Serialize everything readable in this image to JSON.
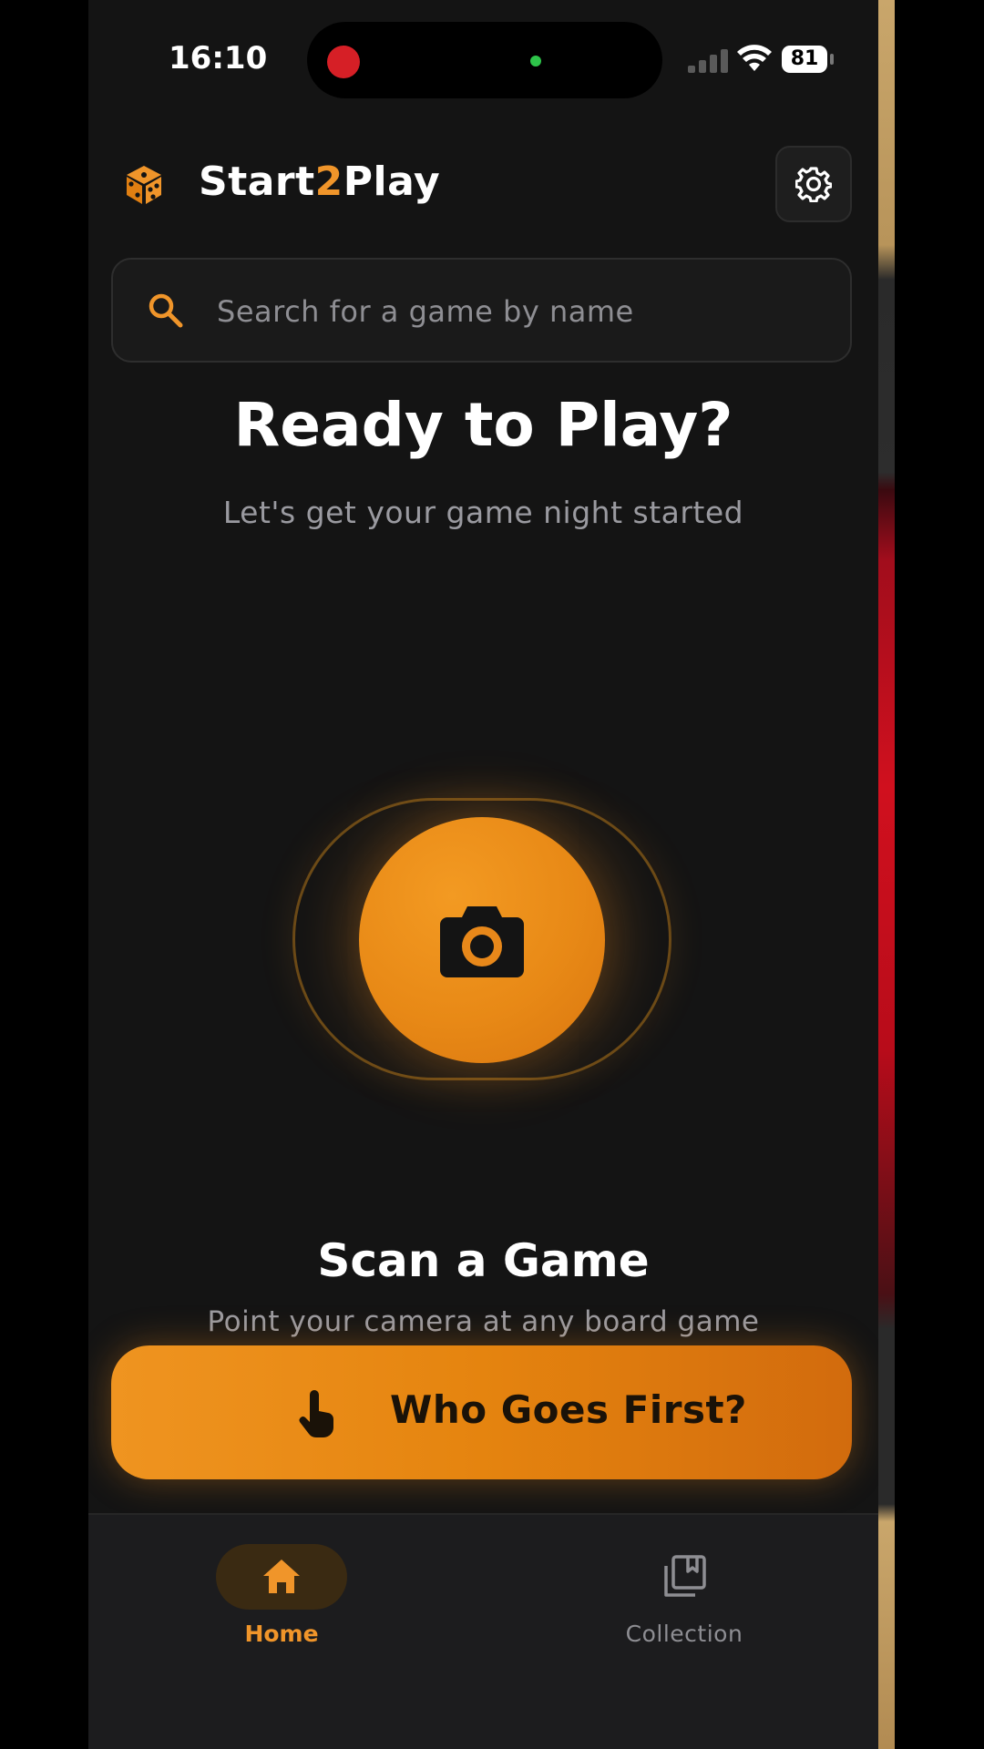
{
  "status_bar": {
    "time": "16:10",
    "battery": "81"
  },
  "header": {
    "title_part1": "Start",
    "title_accent": "2",
    "title_part2": "Play",
    "logo_icon": "dice-icon",
    "settings_icon": "gear-icon"
  },
  "search": {
    "placeholder": "Search for a game by name",
    "value": "",
    "icon": "search-icon"
  },
  "hero": {
    "title": "Ready to Play?",
    "subtitle": "Let's get your game night started"
  },
  "scan": {
    "icon": "camera-icon",
    "title": "Scan a Game",
    "subtitle": "Point your camera at any board game"
  },
  "who_goes_first": {
    "label": "Who Goes First?",
    "icon": "tap-hand-icon"
  },
  "tabs": [
    {
      "label": "Home",
      "icon": "home-icon",
      "active": true
    },
    {
      "label": "Collection",
      "icon": "collection-icon",
      "active": false
    }
  ],
  "colors": {
    "accent": "#f0952a",
    "background": "#141414",
    "surface": "#1a1a1a",
    "muted_text": "#8e8e93"
  }
}
